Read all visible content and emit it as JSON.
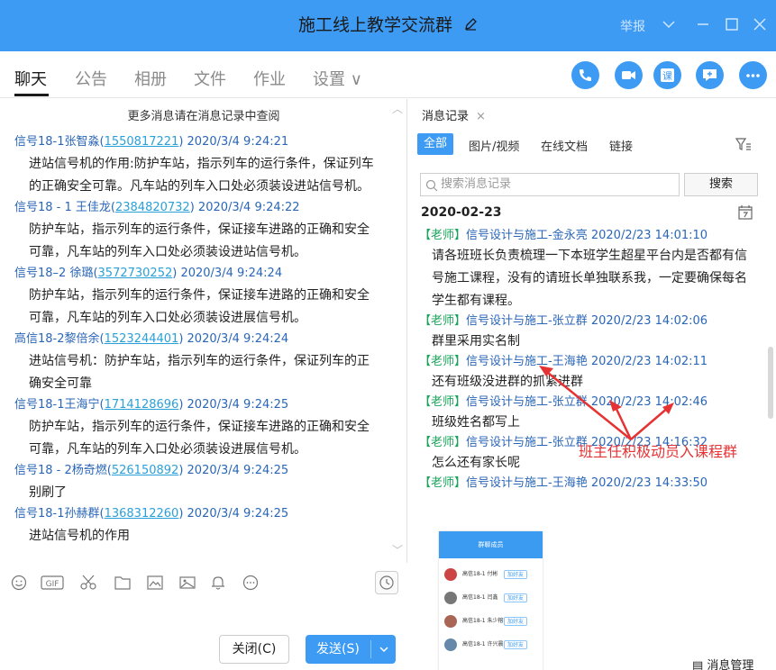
{
  "window": {
    "title": "施工线上教学交流群",
    "report": "举报"
  },
  "nav": {
    "tabs": [
      {
        "label": "聊天"
      },
      {
        "label": "公告"
      },
      {
        "label": "相册"
      },
      {
        "label": "文件"
      },
      {
        "label": "作业"
      },
      {
        "label": "设置 ∨"
      }
    ],
    "actions": [
      "phone-icon",
      "video-icon",
      "course-icon",
      "share-icon",
      "more-icon"
    ],
    "action_labels": {
      "course": "课"
    }
  },
  "left_chat": {
    "history_link": "更多消息请在消息记录中查阅",
    "messages": [
      {
        "sender": "信号18-1张智淼",
        "uid": "1550817221",
        "time": "2020/3/4 9:24:21",
        "lines": [
          "进站信号机的作用:防护车站，指示列车的运行条件，保证列车",
          "的正确安全可靠。凡车站的列车入口处必须装设进站信号机。"
        ]
      },
      {
        "sender": "信号18 - 1  王佳龙",
        "uid": "2384820732",
        "time": "2020/3/4 9:24:22",
        "lines": [
          "防护车站，指示列车的运行条件，保证接车进路的正确和安全",
          "可靠，凡车站的列车入口处必须装设进站信号机。"
        ]
      },
      {
        "sender": "信号18–2 徐璐",
        "uid": "3572730252",
        "time": "2020/3/4 9:24:24",
        "lines": [
          "防护车站，指示列车的运行条件，保证接车进路的正确和安全",
          "可靠，凡车站的列车入口处必须装设进展信号机。"
        ]
      },
      {
        "sender": "高信18-2黎倍余",
        "uid": "1523244401",
        "time": "2020/3/4 9:24:24",
        "lines": [
          "进站信号机：防护车站，指示列车的运行条件，保证列车的正",
          "确安全可靠"
        ]
      },
      {
        "sender": "信号18-1王海宁",
        "uid": "1714128696",
        "time": "2020/3/4 9:24:25",
        "lines": [
          "防护车站，指示列车的运行条件，保证接车进路的正确和安全",
          "可靠，凡车站的列车入口处必须装设进展信号机。"
        ]
      },
      {
        "sender": "信号18 - 2杨奇燃",
        "uid": "526150892",
        "time": "2020/3/4 9:24:25",
        "lines": [
          "别刷了"
        ]
      },
      {
        "sender": "信号18-1孙赫群",
        "uid": "1368312260",
        "time": "2020/3/4 9:24:25",
        "lines": [
          "进站信号机的作用"
        ]
      }
    ]
  },
  "composer": {
    "tools": [
      "emoji-icon",
      "gif-icon",
      "scissors-icon",
      "folder-icon",
      "image-doc-icon",
      "image-icon",
      "bell-icon",
      "more-circle-icon"
    ],
    "gif_label": "GIF",
    "close_label": "关闭(C)",
    "send_label": "发送(S)"
  },
  "history_panel": {
    "tab_label": "消息记录",
    "filters": [
      "全部",
      "图片/视频",
      "在线文档",
      "链接"
    ],
    "search_placeholder": "搜索消息记录",
    "search_button": "搜索",
    "date": "2020-02-23",
    "messages": [
      {
        "role": "【老师】",
        "sender": "信号设计与施工-金永亮",
        "time": "2020/2/23 14:01:10",
        "lines": [
          "请各班班长负责梳理一下本班学生超星平台内是否都有信",
          "号施工课程，没有的请班长单独联系我，一定要确保每名",
          "学生都有课程。"
        ]
      },
      {
        "role": "【老师】",
        "sender": "信号设计与施工-张立群",
        "time": "2020/2/23 14:02:06",
        "lines": [
          "群里采用实名制"
        ]
      },
      {
        "role": "【老师】",
        "sender": "信号设计与施工-王海艳",
        "time": "2020/2/23 14:02:11",
        "lines": [
          "还有班级没进群的抓紧进群"
        ]
      },
      {
        "role": "【老师】",
        "sender": "信号设计与施工-张立群",
        "time": "2020/2/23 14:02:46",
        "lines": [
          "班级姓名都写上"
        ]
      },
      {
        "role": "【老师】",
        "sender": "信号设计与施工-张立群",
        "time": "2020/2/23 14:16:32",
        "lines": [
          "怎么还有家长呢"
        ]
      },
      {
        "role": "【老师】",
        "sender": "信号设计与施工-王海艳",
        "time": "2020/2/23 14:33:50",
        "lines": []
      }
    ],
    "phone_screenshot": {
      "title": "群聊成员",
      "rows": [
        {
          "name": "高信18-1 付彬",
          "btn": "加好友"
        },
        {
          "name": "高信18-1 闫鑫",
          "btn": "加好友"
        },
        {
          "name": "高信18-1 朱少榕",
          "btn": "加好友"
        },
        {
          "name": "高信18-1 许兴晨",
          "btn": "加好友"
        }
      ]
    },
    "annotation": "班主任积极动员入课程群",
    "manage_label": "消息管理"
  },
  "colors": {
    "accent": "#3d9bf3",
    "link": "#2a66b8",
    "teacher": "#1aa35b",
    "annotation": "#e63232"
  }
}
